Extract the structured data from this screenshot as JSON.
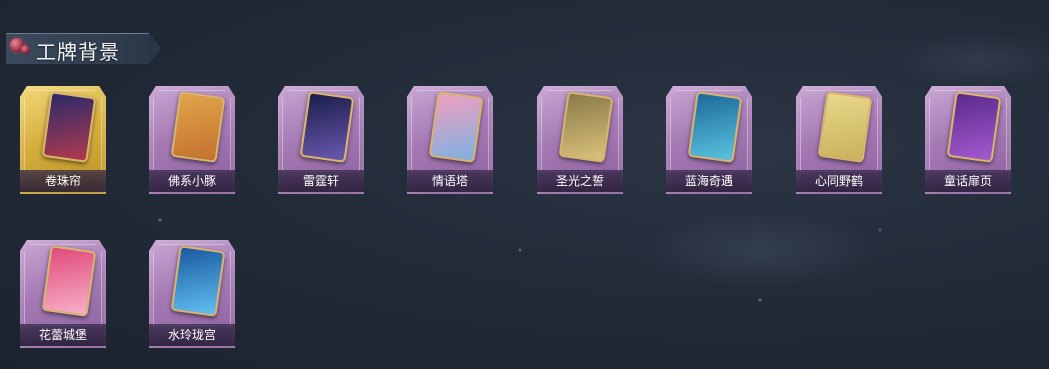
{
  "section": {
    "title": "工牌背景"
  },
  "cards": [
    {
      "label": "卷珠帘",
      "variant": "gold",
      "art_colors": [
        "#2a2a6a",
        "#b23a4e"
      ]
    },
    {
      "label": "佛系小豚",
      "variant": "purple",
      "art_colors": [
        "#e0a54a",
        "#c4712e"
      ]
    },
    {
      "label": "雷霆轩",
      "variant": "purple",
      "art_colors": [
        "#1a1e4a",
        "#6b58b0"
      ]
    },
    {
      "label": "情语塔",
      "variant": "purple",
      "art_colors": [
        "#f0a0c0",
        "#7fb0e0"
      ]
    },
    {
      "label": "圣光之誓",
      "variant": "purple",
      "art_colors": [
        "#8a7a4a",
        "#d9c27a"
      ]
    },
    {
      "label": "蓝海奇遇",
      "variant": "purple",
      "art_colors": [
        "#1c6a9a",
        "#5ac3e0"
      ]
    },
    {
      "label": "心同野鹤",
      "variant": "purple",
      "art_colors": [
        "#e8d88a",
        "#c8b25a"
      ]
    },
    {
      "label": "童话扉页",
      "variant": "purple",
      "art_colors": [
        "#5a2a8a",
        "#a45ad0"
      ]
    },
    {
      "label": "花蕾城堡",
      "variant": "purple",
      "art_colors": [
        "#e04a7a",
        "#f8b0c8"
      ]
    },
    {
      "label": "水玲珑宫",
      "variant": "purple",
      "art_colors": [
        "#1a5aa0",
        "#60c0f0"
      ]
    }
  ]
}
